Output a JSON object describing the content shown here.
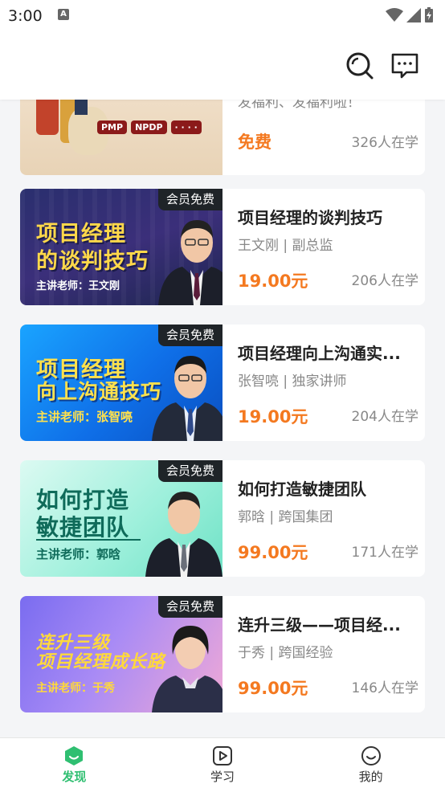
{
  "status": {
    "time": "3:00",
    "a_icon": "A"
  },
  "app_bar": {
    "icons": [
      "search-icon",
      "message-icon"
    ]
  },
  "courses": [
    {
      "title": "",
      "subtitle": "发福利、发福利啦！",
      "price": "免费",
      "learners": "326人在学",
      "pills": [
        "PMP",
        "NPDP",
        "· · · ·"
      ],
      "badge": ""
    },
    {
      "title": "项目经理的谈判技巧",
      "subtitle": "王文刚 | 副总监",
      "price": "19.00元",
      "learners": "206人在学",
      "badge": "会员免费",
      "banner_line1": "项目经理",
      "banner_line2": "的谈判技巧",
      "banner_teacher": "主讲老师：王文刚"
    },
    {
      "title": "项目经理向上沟通实...",
      "subtitle": "张智喨 | 独家讲师",
      "price": "19.00元",
      "learners": "204人在学",
      "badge": "会员免费",
      "banner_line1": "项目经理",
      "banner_line2": "向上沟通技巧",
      "banner_teacher": "主讲老师：张智喨"
    },
    {
      "title": "如何打造敏捷团队",
      "subtitle": "郭晗 | 跨国集团",
      "price": "99.00元",
      "learners": "171人在学",
      "badge": "会员免费",
      "banner_line1": "如何打造",
      "banner_line2": "敏捷团队",
      "banner_teacher": "主讲老师：郭晗"
    },
    {
      "title": "连升三级——项目经...",
      "subtitle": "于秀 | 跨国经验",
      "price": "99.00元",
      "learners": "146人在学",
      "badge": "会员免费",
      "banner_line1": "连升三级",
      "banner_line2": "项目经理成长路",
      "banner_teacher": "主讲老师：于秀"
    }
  ],
  "tabs": [
    {
      "label": "发现",
      "icon": "discover-icon",
      "active": true
    },
    {
      "label": "学习",
      "icon": "play-icon",
      "active": false
    },
    {
      "label": "我的",
      "icon": "smile-icon",
      "active": false
    }
  ],
  "colors": {
    "accent_green": "#2fbf71",
    "price_orange": "#f47920"
  }
}
